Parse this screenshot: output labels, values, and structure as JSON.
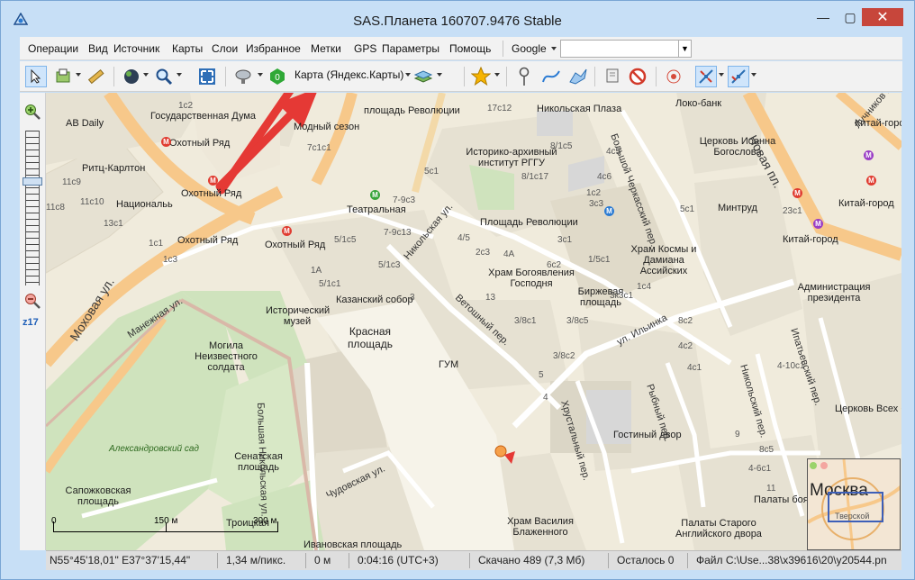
{
  "window": {
    "title": "SAS.Планета 160707.9476 Stable",
    "controls": {
      "minimize": "—",
      "maximize": "▢",
      "close": "✕"
    }
  },
  "menu": {
    "items": [
      "Операции",
      "Вид",
      "Источник",
      "Карты",
      "Слои",
      "Избранное",
      "Метки",
      "GPS",
      "Параметры",
      "Помощь"
    ],
    "search_provider": "Google",
    "search_value": ""
  },
  "toolbar": {
    "map_source": "Карта (Яндекс.Карты)"
  },
  "zoom": {
    "level": "z17",
    "slider_fraction": 0.55
  },
  "map": {
    "labels": [
      "1c2",
      "Государственная Дума",
      "Охотный Ряд",
      "AB Daily",
      "Ритц-Карлтон",
      "11с9",
      "Национальь",
      "11с8",
      "11с10",
      "13с1",
      "Охотный Ряд",
      "Охотный Ряд",
      "Охотный Ряд",
      "Модный сезон",
      "площадь Революции",
      "7с1с1",
      "Театральная",
      "7-9с3",
      "5/1с5",
      "7-9с13",
      "1A",
      "5/1с1",
      "5/1с3",
      "Исторический музей",
      "Казанский собор",
      "Красная площадь",
      "3",
      "ГУМ",
      "Могила Неизвестного солдата",
      "Сенатская площадь",
      "Сапожковская площадь",
      "Ивановская площадь",
      "17с12",
      "Никольская Плаза",
      "Историко-архивный институт РГГУ",
      "8/1с5",
      "8/1с17",
      "5с1",
      "Площадь Революции",
      "3с3",
      "4с6",
      "4с5",
      "2с3",
      "4А",
      "4/5",
      "Храм Богоявления Господня",
      "6с2",
      "13",
      "3/8с1",
      "3/8с5",
      "3/8с2",
      "3с1",
      "1/5с1",
      "Биржевая площадь",
      "Храм Космы и Дамиана Ассийских",
      "3к3с1",
      "Гостиный двор",
      "8с2",
      "4с2",
      "4с1",
      "5с1",
      "Минтруд",
      "Локо-банк",
      "Церковь Иоанна Богослова",
      "Китай-город",
      "Китай-город",
      "Китай-город",
      "Администрация президента",
      "23с1",
      "4-10с1",
      "Церковь Всех Святых",
      "8с5",
      "4-6с1",
      "Храм Василия Блаженного",
      "Палаты Старого Английского двора",
      "Палаты бояр",
      "Троицкая",
      "4",
      "9",
      "11",
      "5",
      "1с1",
      "1с3",
      "1с2",
      "1с4"
    ],
    "streets": [
      "Моховая ул.",
      "Манежная ул.",
      "Никольская ул.",
      "Ветошный пер.",
      "ул. Ильинка",
      "Большой Черкасский пер.",
      "Новая пл.",
      "Рыбный пер.",
      "Хрустальный пер.",
      "Никольский пер.",
      "Ипатьевский пер.",
      "Большая Никольская ул.",
      "Чудовская ул.",
      "Лучников пер."
    ],
    "parks": [
      "Александровский сад"
    ],
    "scale": {
      "zero": "0",
      "mid": "150 м",
      "end": "300 м"
    },
    "minimap": {
      "city": "Москва",
      "district": "Тверской"
    }
  },
  "statusbar": {
    "coords": "N55°45'18,01\" E37°37'15,44\"",
    "resolution": "1,34 м/пикс.",
    "distance": "0 м",
    "time": "0:04:16 (UTC+3)",
    "downloaded": "Скачано 489 (7,3 Мб)",
    "remaining": "Осталось 0",
    "file": "Файл C:\\Use...38\\x39616\\20\\y20544.pn"
  },
  "colors": {
    "titlebar": "#c7dff6",
    "map_background": "#f2eee1",
    "major_road": "#f7c88a",
    "park": "#cfe3bd",
    "metro": "#e03c31",
    "metro_purple": "#9a3ec5",
    "metro_green": "#38a43b",
    "arrow": "#e53935"
  }
}
